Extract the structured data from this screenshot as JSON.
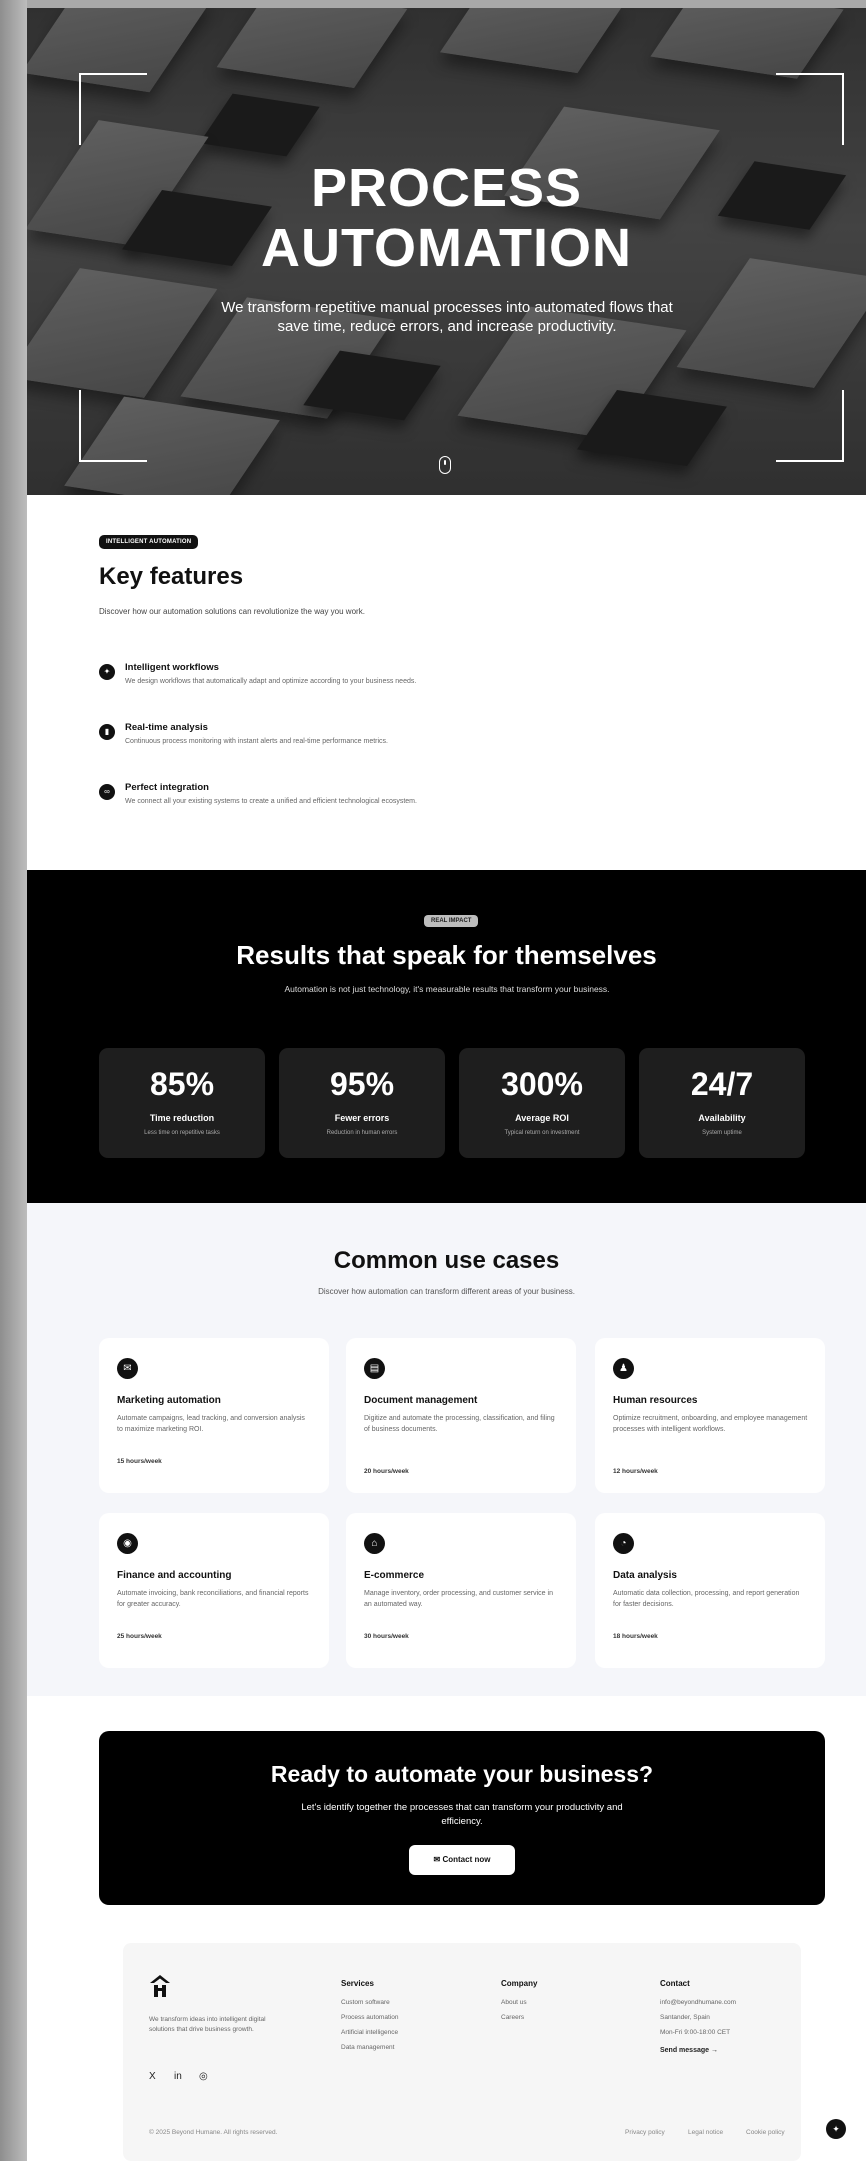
{
  "hero": {
    "title_line1": "PROCESS",
    "title_line2": "AUTOMATION",
    "subtitle": "We transform repetitive manual processes into automated flows that save time, reduce errors, and increase productivity."
  },
  "features": {
    "badge": "INTELLIGENT AUTOMATION",
    "title": "Key features",
    "description": "Discover how our automation solutions can revolutionize the way you work.",
    "items": [
      {
        "name": "Intelligent workflows",
        "text": "We design workflows that automatically adapt and optimize according to your business needs.",
        "icon": "sparkle-icon"
      },
      {
        "name": "Real-time analysis",
        "text": "Continuous process monitoring with instant alerts and real-time performance metrics.",
        "icon": "chart-icon"
      },
      {
        "name": "Perfect integration",
        "text": "We connect all your existing systems to create a unified and efficient technological ecosystem.",
        "icon": "link-icon"
      }
    ]
  },
  "results": {
    "badge": "REAL IMPACT",
    "title": "Results that speak for themselves",
    "description": "Automation is not just technology, it's measurable results that transform your business.",
    "stats": [
      {
        "value": "85%",
        "label": "Time reduction",
        "sub": "Less time on repetitive tasks"
      },
      {
        "value": "95%",
        "label": "Fewer errors",
        "sub": "Reduction in human errors"
      },
      {
        "value": "300%",
        "label": "Average ROI",
        "sub": "Typical return on investment"
      },
      {
        "value": "24/7",
        "label": "Availability",
        "sub": "System uptime"
      }
    ]
  },
  "usecases": {
    "title": "Common use cases",
    "description": "Discover how automation can transform different areas of your business.",
    "cards": [
      {
        "name": "Marketing automation",
        "text": "Automate campaigns, lead tracking, and conversion analysis to maximize marketing ROI.",
        "hours": "15 hours/week",
        "icon": "mail-icon"
      },
      {
        "name": "Document management",
        "text": "Digitize and automate the processing, classification, and filing of business documents.",
        "hours": "20 hours/week",
        "icon": "document-icon"
      },
      {
        "name": "Human resources",
        "text": "Optimize recruitment, onboarding, and employee management processes with intelligent workflows.",
        "hours": "12 hours/week",
        "icon": "people-icon"
      },
      {
        "name": "Finance and accounting",
        "text": "Automate invoicing, bank reconciliations, and financial reports for greater accuracy.",
        "hours": "25 hours/week",
        "icon": "coin-icon"
      },
      {
        "name": "E-commerce",
        "text": "Manage inventory, order processing, and customer service in an automated way.",
        "hours": "30 hours/week",
        "icon": "bag-icon"
      },
      {
        "name": "Data analysis",
        "text": "Automatic data collection, processing, and report generation for faster decisions.",
        "hours": "18 hours/week",
        "icon": "analytics-icon"
      }
    ]
  },
  "cta": {
    "title": "Ready to automate your business?",
    "description": "Let's identify together the processes that can transform your productivity and efficiency.",
    "button": "Contact now"
  },
  "footer": {
    "about": "We transform ideas into intelligent digital solutions that drive business growth.",
    "social": [
      "X",
      "in",
      "◎"
    ],
    "columns": [
      {
        "heading": "Services",
        "links": [
          "Custom software",
          "Process automation",
          "Artificial intelligence",
          "Data management"
        ]
      },
      {
        "heading": "Company",
        "links": [
          "About us",
          "Careers"
        ]
      },
      {
        "heading": "Contact",
        "links": [
          "info@beyondhumane.com",
          "Santander, Spain",
          "Mon-Fri 9:00-18:00 CET"
        ]
      }
    ],
    "send_message": "Send message →",
    "copyright": "© 2025 Beyond Humane. All rights reserved.",
    "legal": [
      "Privacy policy",
      "Legal notice",
      "Cookie policy"
    ]
  }
}
